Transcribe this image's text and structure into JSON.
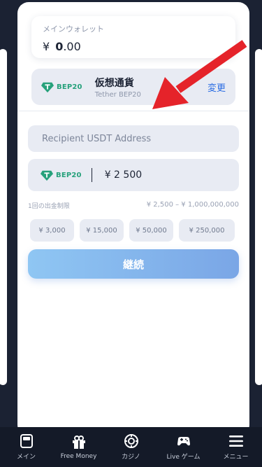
{
  "wallet": {
    "label": "メインウォレット",
    "currency_symbol": "¥",
    "balance_int": "0",
    "balance_dec": ".00"
  },
  "currency": {
    "badge": "BEP20",
    "title": "仮想通貨",
    "subtitle": "Tether BEP20",
    "change_label": "変更"
  },
  "form": {
    "address_placeholder": "Recipient USDT Address",
    "amount_badge": "BEP20",
    "amount_value": "¥ 2 500",
    "limit_label": "1回の出金制限",
    "limit_range": "¥ 2,500 – ¥ 1,000,000,000",
    "presets": [
      "¥ 3,000",
      "¥ 15,000",
      "¥ 50,000",
      "¥ 250,000"
    ],
    "continue_label": "継続"
  },
  "nav": {
    "items": [
      {
        "label": "メイン",
        "icon": "home-icon"
      },
      {
        "label": "Free Money",
        "icon": "gift-icon"
      },
      {
        "label": "カジノ",
        "icon": "casino-chip-icon"
      },
      {
        "label": "Live ゲーム",
        "icon": "gamepad-icon"
      },
      {
        "label": "メニュー",
        "icon": "menu-icon"
      }
    ]
  },
  "colors": {
    "accent_blue": "#2b6de3",
    "tether_green": "#26a17b",
    "arrow_red": "#e5232a",
    "nav_bg": "#141a28"
  }
}
